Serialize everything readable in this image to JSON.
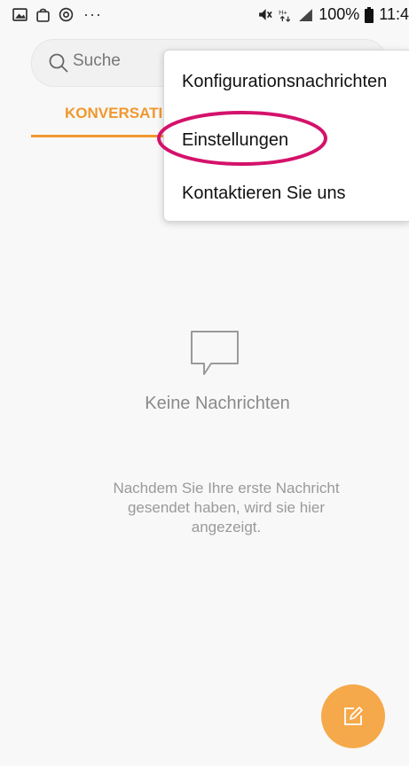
{
  "status_bar": {
    "dots": "···",
    "battery": "100%",
    "time": "11:4"
  },
  "search": {
    "placeholder": "Suche"
  },
  "tabs": {
    "conversations": "KONVERSATION"
  },
  "menu": {
    "items": [
      {
        "label": "Konfigurationsnachrichten"
      },
      {
        "label": "Einstellungen"
      },
      {
        "label": "Kontaktieren Sie uns"
      }
    ]
  },
  "empty_state": {
    "title": "Keine Nachrichten",
    "description": "Nachdem Sie Ihre erste Nachricht gesendet haben, wird sie hier angezeigt."
  },
  "colors": {
    "accent": "#f0982e",
    "fab": "#f5a94a",
    "highlight_circle": "#d4126b"
  },
  "icons": {
    "search": "search-icon",
    "compose": "compose-icon",
    "empty": "chat-bubble-icon"
  }
}
